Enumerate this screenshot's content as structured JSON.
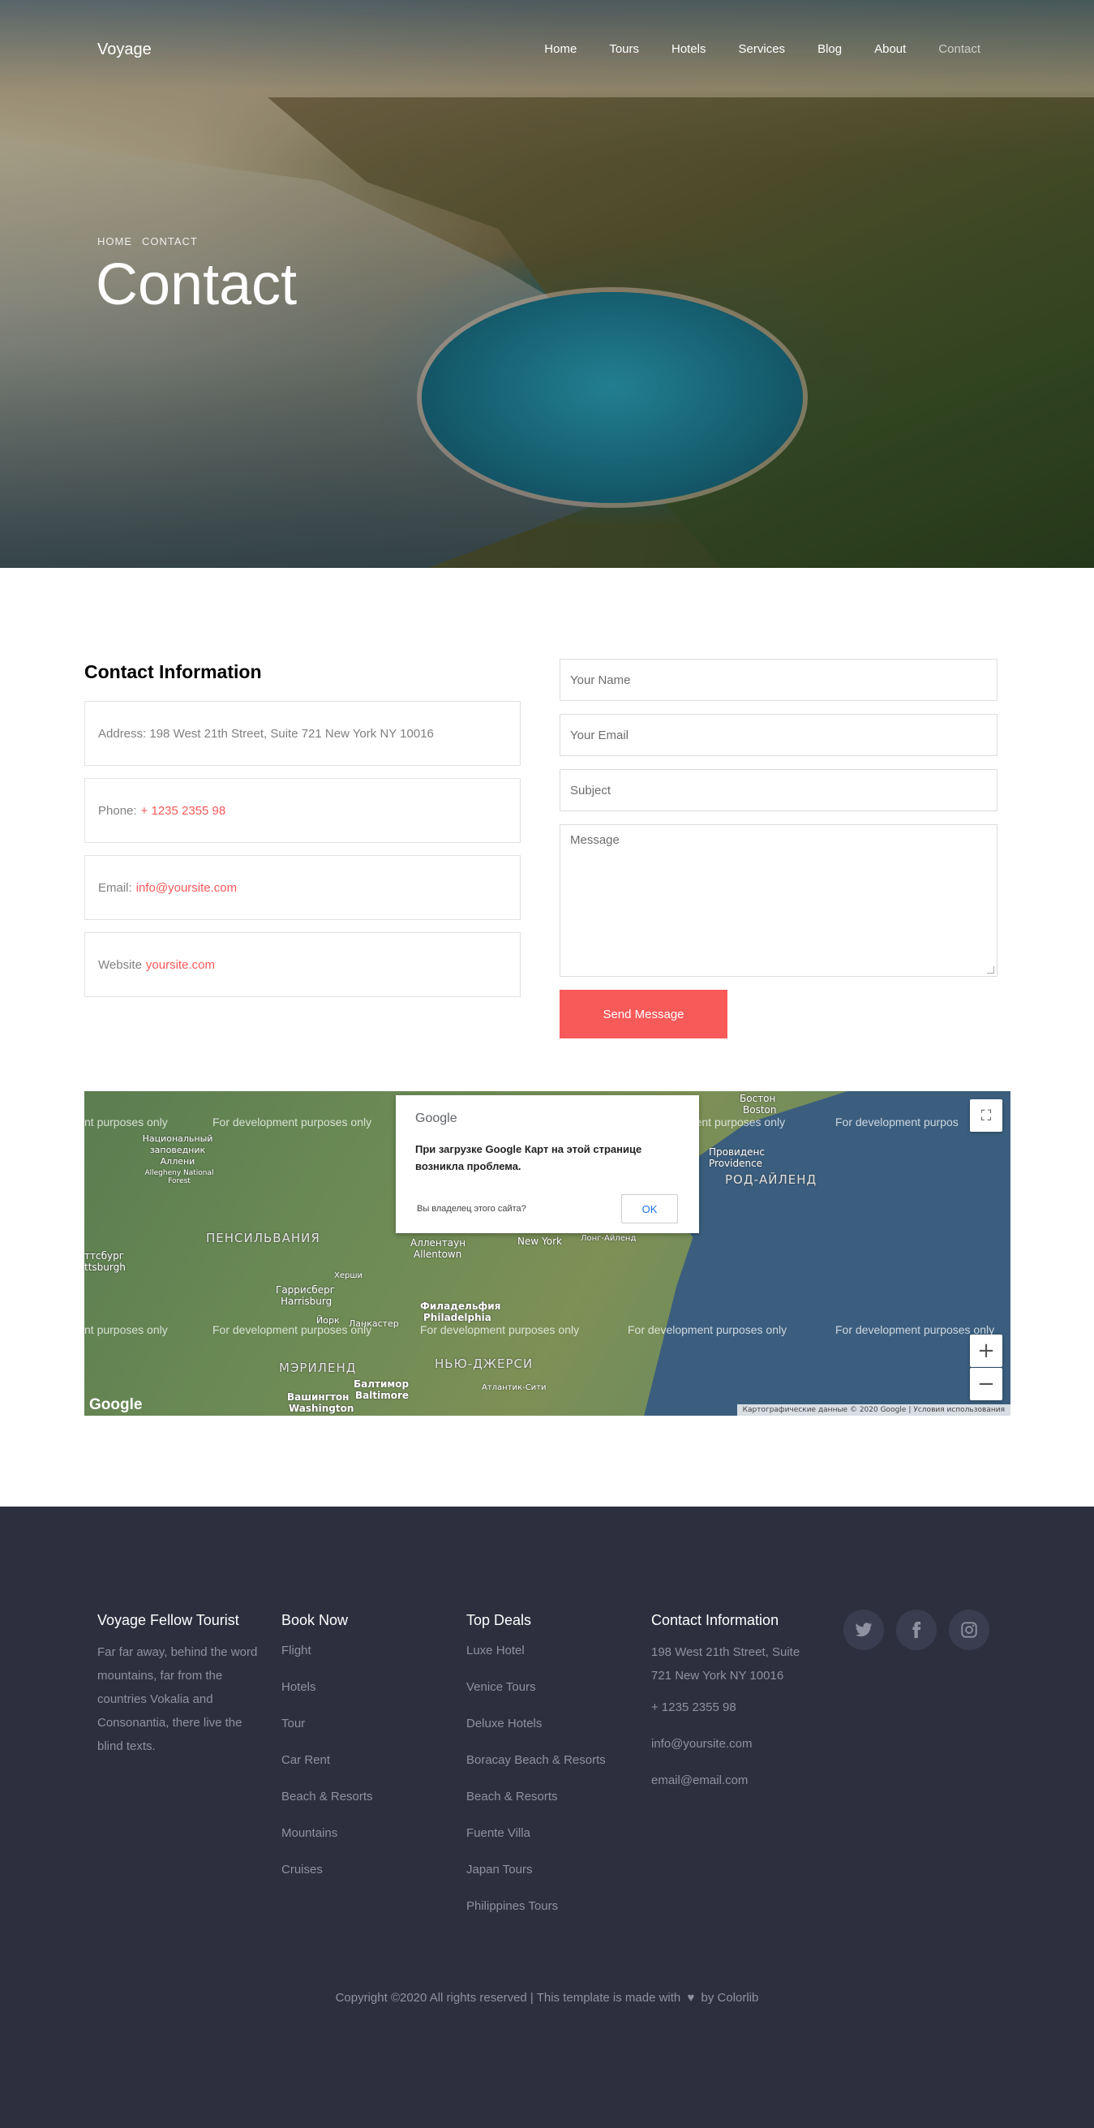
{
  "nav": {
    "brand": "Voyage",
    "items": [
      {
        "label": "Home",
        "active": false
      },
      {
        "label": "Tours",
        "active": false
      },
      {
        "label": "Hotels",
        "active": false
      },
      {
        "label": "Services",
        "active": false
      },
      {
        "label": "Blog",
        "active": false
      },
      {
        "label": "About",
        "active": false
      },
      {
        "label": "Contact",
        "active": true
      }
    ]
  },
  "hero": {
    "breadcrumb": [
      "HOME",
      "CONTACT"
    ],
    "title": "Contact"
  },
  "contact_info": {
    "title": "Contact Information",
    "address_label": "Address:",
    "address_value": "198 West 21th Street, Suite 721 New York NY 10016",
    "phone_label": "Phone:",
    "phone_value": "+ 1235 2355 98",
    "email_label": "Email:",
    "email_value": "info@yoursite.com",
    "website_label": "Website",
    "website_value": "yoursite.com"
  },
  "form": {
    "name_placeholder": "Your Name",
    "email_placeholder": "Your Email",
    "subject_placeholder": "Subject",
    "message_placeholder": "Message",
    "submit_label": "Send Message"
  },
  "map": {
    "watermark": "For development purposes only",
    "watermark_cut_left": "nt purposes only",
    "watermark_cut_right": "For development purpos",
    "dialog_brand": "Google",
    "dialog_message": "При загрузке Google Карт на этой странице возникла проблема.",
    "dialog_owner": "Вы владелец этого сайта?",
    "dialog_ok": "OK",
    "labels": {
      "pennsylvania": "ПЕНСИЛЬВАНИЯ",
      "maryland": "МЭРИЛЕНД",
      "new_jersey": "НЬЮ-ДЖЕРСИ",
      "rhode_island": "РОД-АЙЛЕНД",
      "boston_ru": "Бостон",
      "boston_en": "Boston",
      "providence_ru": "Провиденс",
      "providence_en": "Providence",
      "new_york": "New York",
      "long_island": "Лонг-Айленд",
      "allentown_ru": "Аллентаун",
      "allentown_en": "Allentown",
      "harrisburg_ru": "Гаррисберг",
      "harrisburg_en": "Harrisburg",
      "philadelphia_ru": "Филадельфия",
      "philadelphia_en": "Philadelphia",
      "baltimore_ru": "Балтимор",
      "baltimore_en": "Baltimore",
      "washington_ru": "Вашингтон",
      "washington_en": "Washington",
      "pittsburgh_ru": "ттсбург",
      "pittsburgh_en": "ttsburgh",
      "allegheny": "Национальный заповедник Аллени",
      "allegheny_en": "Allegheny National Forest",
      "york": "Йорк",
      "lancaster": "Ланкастер",
      "atlantic_city": "Атлантик-Сити",
      "hershey": "Херши"
    },
    "zoom_in": "+",
    "zoom_out": "−",
    "fullscreen": "⛶",
    "logo": "Google",
    "attribution": "Картографические данные © 2020 Google",
    "terms": "Условия использования"
  },
  "footer": {
    "about_title": "Voyage Fellow Tourist",
    "about_text": "Far far away, behind the word mountains, far from the countries Vokalia and Consonantia, there live the blind texts.",
    "book_title": "Book Now",
    "book_items": [
      "Flight",
      "Hotels",
      "Tour",
      "Car Rent",
      "Beach & Resorts",
      "Mountains",
      "Cruises"
    ],
    "deals_title": "Top Deals",
    "deals_items": [
      "Luxe Hotel",
      "Venice Tours",
      "Deluxe Hotels",
      "Boracay Beach & Resorts",
      "Beach & Resorts",
      "Fuente Villa",
      "Japan Tours",
      "Philippines Tours"
    ],
    "contact_title": "Contact Information",
    "contact_address": "198 West 21th Street, Suite 721 New York NY 10016",
    "contact_phone": "+ 1235 2355 98",
    "contact_email1": "info@yoursite.com",
    "contact_email2": "email@email.com",
    "social": [
      {
        "icon": "twitter-icon",
        "glyph": "🐦"
      },
      {
        "icon": "facebook-icon",
        "glyph": "f"
      },
      {
        "icon": "instagram-icon",
        "glyph": "◎"
      }
    ],
    "copyright_pre": "Copyright ©2020 All rights reserved | This template is made with",
    "copyright_heart": "♥",
    "copyright_post": "by Colorlib"
  },
  "colors": {
    "accent": "#f85959",
    "footer_bg": "#2d2f3e",
    "footer_text": "#8f91a0",
    "map_sea": "#3b5e7e"
  }
}
